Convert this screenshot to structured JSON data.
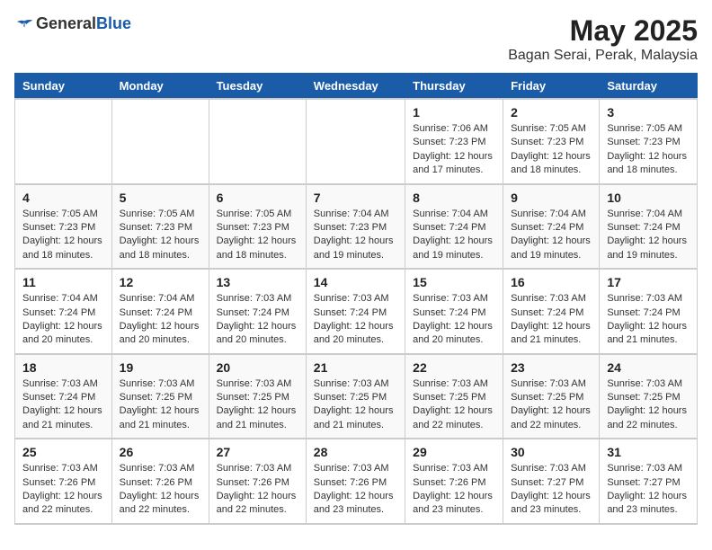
{
  "header": {
    "logo_general": "General",
    "logo_blue": "Blue",
    "month_title": "May 2025",
    "location": "Bagan Serai, Perak, Malaysia"
  },
  "weekdays": [
    "Sunday",
    "Monday",
    "Tuesday",
    "Wednesday",
    "Thursday",
    "Friday",
    "Saturday"
  ],
  "weeks": [
    [
      {
        "day": "",
        "info": ""
      },
      {
        "day": "",
        "info": ""
      },
      {
        "day": "",
        "info": ""
      },
      {
        "day": "",
        "info": ""
      },
      {
        "day": "1",
        "info": "Sunrise: 7:06 AM\nSunset: 7:23 PM\nDaylight: 12 hours\nand 17 minutes."
      },
      {
        "day": "2",
        "info": "Sunrise: 7:05 AM\nSunset: 7:23 PM\nDaylight: 12 hours\nand 18 minutes."
      },
      {
        "day": "3",
        "info": "Sunrise: 7:05 AM\nSunset: 7:23 PM\nDaylight: 12 hours\nand 18 minutes."
      }
    ],
    [
      {
        "day": "4",
        "info": "Sunrise: 7:05 AM\nSunset: 7:23 PM\nDaylight: 12 hours\nand 18 minutes."
      },
      {
        "day": "5",
        "info": "Sunrise: 7:05 AM\nSunset: 7:23 PM\nDaylight: 12 hours\nand 18 minutes."
      },
      {
        "day": "6",
        "info": "Sunrise: 7:05 AM\nSunset: 7:23 PM\nDaylight: 12 hours\nand 18 minutes."
      },
      {
        "day": "7",
        "info": "Sunrise: 7:04 AM\nSunset: 7:23 PM\nDaylight: 12 hours\nand 19 minutes."
      },
      {
        "day": "8",
        "info": "Sunrise: 7:04 AM\nSunset: 7:24 PM\nDaylight: 12 hours\nand 19 minutes."
      },
      {
        "day": "9",
        "info": "Sunrise: 7:04 AM\nSunset: 7:24 PM\nDaylight: 12 hours\nand 19 minutes."
      },
      {
        "day": "10",
        "info": "Sunrise: 7:04 AM\nSunset: 7:24 PM\nDaylight: 12 hours\nand 19 minutes."
      }
    ],
    [
      {
        "day": "11",
        "info": "Sunrise: 7:04 AM\nSunset: 7:24 PM\nDaylight: 12 hours\nand 20 minutes."
      },
      {
        "day": "12",
        "info": "Sunrise: 7:04 AM\nSunset: 7:24 PM\nDaylight: 12 hours\nand 20 minutes."
      },
      {
        "day": "13",
        "info": "Sunrise: 7:03 AM\nSunset: 7:24 PM\nDaylight: 12 hours\nand 20 minutes."
      },
      {
        "day": "14",
        "info": "Sunrise: 7:03 AM\nSunset: 7:24 PM\nDaylight: 12 hours\nand 20 minutes."
      },
      {
        "day": "15",
        "info": "Sunrise: 7:03 AM\nSunset: 7:24 PM\nDaylight: 12 hours\nand 20 minutes."
      },
      {
        "day": "16",
        "info": "Sunrise: 7:03 AM\nSunset: 7:24 PM\nDaylight: 12 hours\nand 21 minutes."
      },
      {
        "day": "17",
        "info": "Sunrise: 7:03 AM\nSunset: 7:24 PM\nDaylight: 12 hours\nand 21 minutes."
      }
    ],
    [
      {
        "day": "18",
        "info": "Sunrise: 7:03 AM\nSunset: 7:24 PM\nDaylight: 12 hours\nand 21 minutes."
      },
      {
        "day": "19",
        "info": "Sunrise: 7:03 AM\nSunset: 7:25 PM\nDaylight: 12 hours\nand 21 minutes."
      },
      {
        "day": "20",
        "info": "Sunrise: 7:03 AM\nSunset: 7:25 PM\nDaylight: 12 hours\nand 21 minutes."
      },
      {
        "day": "21",
        "info": "Sunrise: 7:03 AM\nSunset: 7:25 PM\nDaylight: 12 hours\nand 21 minutes."
      },
      {
        "day": "22",
        "info": "Sunrise: 7:03 AM\nSunset: 7:25 PM\nDaylight: 12 hours\nand 22 minutes."
      },
      {
        "day": "23",
        "info": "Sunrise: 7:03 AM\nSunset: 7:25 PM\nDaylight: 12 hours\nand 22 minutes."
      },
      {
        "day": "24",
        "info": "Sunrise: 7:03 AM\nSunset: 7:25 PM\nDaylight: 12 hours\nand 22 minutes."
      }
    ],
    [
      {
        "day": "25",
        "info": "Sunrise: 7:03 AM\nSunset: 7:26 PM\nDaylight: 12 hours\nand 22 minutes."
      },
      {
        "day": "26",
        "info": "Sunrise: 7:03 AM\nSunset: 7:26 PM\nDaylight: 12 hours\nand 22 minutes."
      },
      {
        "day": "27",
        "info": "Sunrise: 7:03 AM\nSunset: 7:26 PM\nDaylight: 12 hours\nand 22 minutes."
      },
      {
        "day": "28",
        "info": "Sunrise: 7:03 AM\nSunset: 7:26 PM\nDaylight: 12 hours\nand 23 minutes."
      },
      {
        "day": "29",
        "info": "Sunrise: 7:03 AM\nSunset: 7:26 PM\nDaylight: 12 hours\nand 23 minutes."
      },
      {
        "day": "30",
        "info": "Sunrise: 7:03 AM\nSunset: 7:27 PM\nDaylight: 12 hours\nand 23 minutes."
      },
      {
        "day": "31",
        "info": "Sunrise: 7:03 AM\nSunset: 7:27 PM\nDaylight: 12 hours\nand 23 minutes."
      }
    ]
  ]
}
